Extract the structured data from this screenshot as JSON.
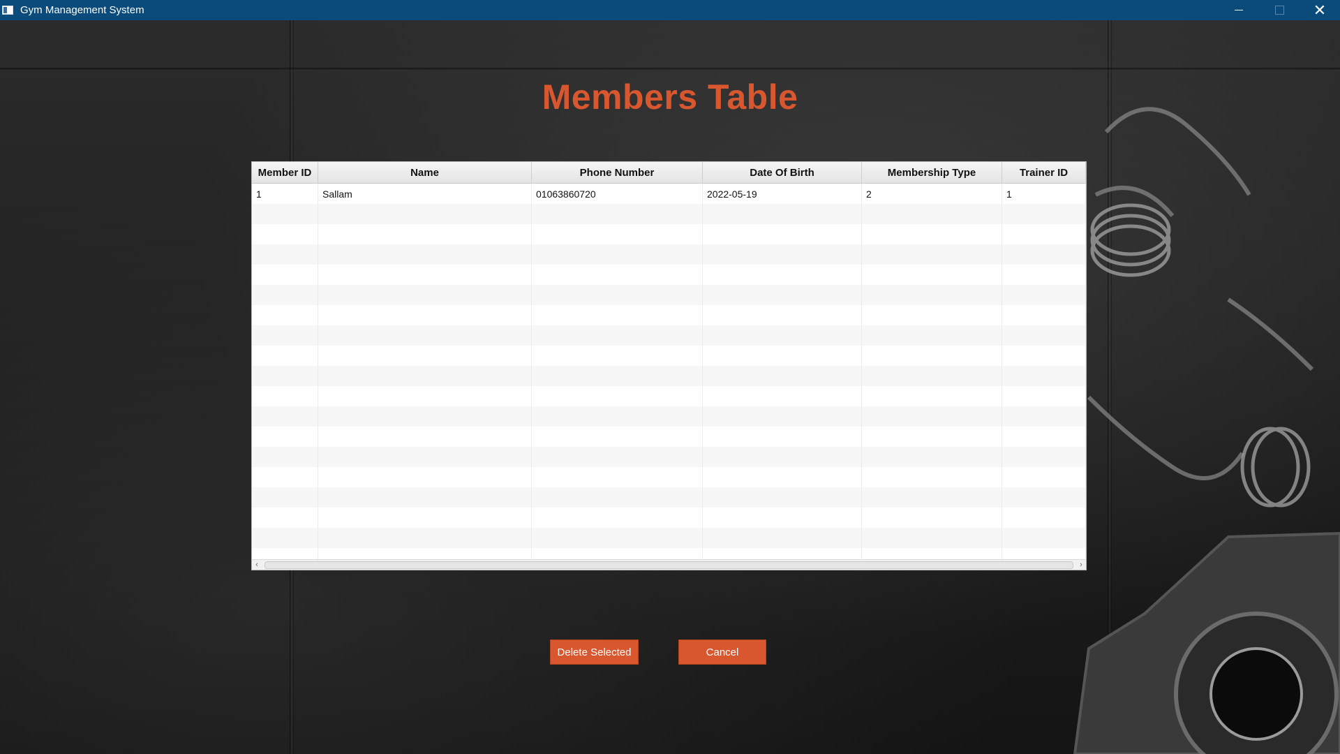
{
  "window": {
    "title": "Gym Management System",
    "controls": {
      "minimize": "minimize",
      "maximize": "maximize",
      "close": "close"
    }
  },
  "page": {
    "title": "Members Table",
    "accent_color": "#d9572f",
    "titlebar_color": "#0a4b7c"
  },
  "table": {
    "columns": [
      "Member ID",
      "Name",
      "Phone Number",
      "Date Of Birth",
      "Membership Type",
      "Trainer ID"
    ],
    "rows": [
      [
        "1",
        "Sallam",
        "01063860720",
        "2022-05-19",
        "2",
        "1"
      ]
    ],
    "visible_empty_rows": 18
  },
  "actions": {
    "delete_label": "Delete Selected",
    "cancel_label": "Cancel"
  }
}
